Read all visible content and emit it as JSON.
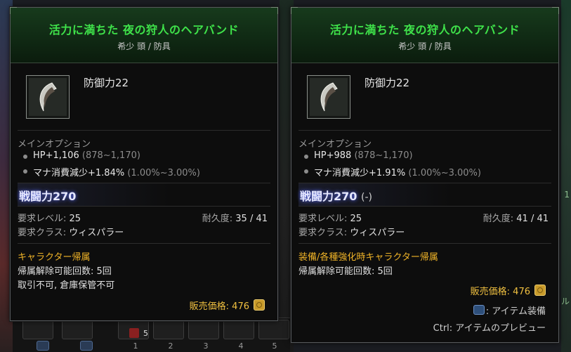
{
  "tooltips": [
    {
      "name": "活力に満ちた 夜の狩人のヘアバンド",
      "subtitle": "希少 頭 / 防具",
      "defense": "防御力22",
      "main_option_title": "メインオプション",
      "options": [
        {
          "text": "HP+1,106",
          "range": "(878~1,170)"
        },
        {
          "text": "マナ消費減少+1.84%",
          "range": "(1.00%~3.00%)"
        }
      ],
      "combat_power": "戦闘力270",
      "combat_power_diff": "",
      "req_level_label": "要求レベル:",
      "req_level": "25",
      "req_class_label": "要求クラス:",
      "req_class": "ウィスパラー",
      "durability_label": "耐久度:",
      "durability": "35 / 41",
      "bind_title": "キャラクター帰属",
      "bind_lines": [
        "帰属解除可能回数: 5回",
        "取引不可, 倉庫保管不可"
      ],
      "price_label": "販売価格:",
      "price": "476"
    },
    {
      "name": "活力に満ちた 夜の狩人のヘアバンド",
      "subtitle": "希少 頭 / 防具",
      "defense": "防御力22",
      "main_option_title": "メインオプション",
      "options": [
        {
          "text": "HP+988",
          "range": "(878~1,170)"
        },
        {
          "text": "マナ消費減少+1.91%",
          "range": "(1.00%~3.00%)"
        }
      ],
      "combat_power": "戦闘力270",
      "combat_power_diff": "(-)",
      "req_level_label": "要求レベル:",
      "req_level": "25",
      "req_class_label": "要求クラス:",
      "req_class": "ウィスパラー",
      "durability_label": "耐久度:",
      "durability": "41 / 41",
      "bind_title": "装備/各種強化時キャラクター帰属",
      "bind_lines": [
        "帰属解除可能回数: 5回"
      ],
      "price_label": "販売価格:",
      "price": "476",
      "hint_equip": ": アイテム装備",
      "hint_preview": "Ctrl: アイテムのプレビュー"
    }
  ],
  "hotbar": {
    "slot_numbers": [
      "1",
      "2",
      "3",
      "4",
      "5"
    ],
    "stack_count": "5"
  },
  "colors": {
    "item_name": "#3fe24a",
    "bind_title": "#f0b428",
    "price": "#f0c040",
    "combat_power_glow": "#5a6cff"
  },
  "icons": {
    "item": "headband-claw-icon",
    "currency": "gold-coin-icon",
    "mouse": "right-click-mouse-icon"
  }
}
